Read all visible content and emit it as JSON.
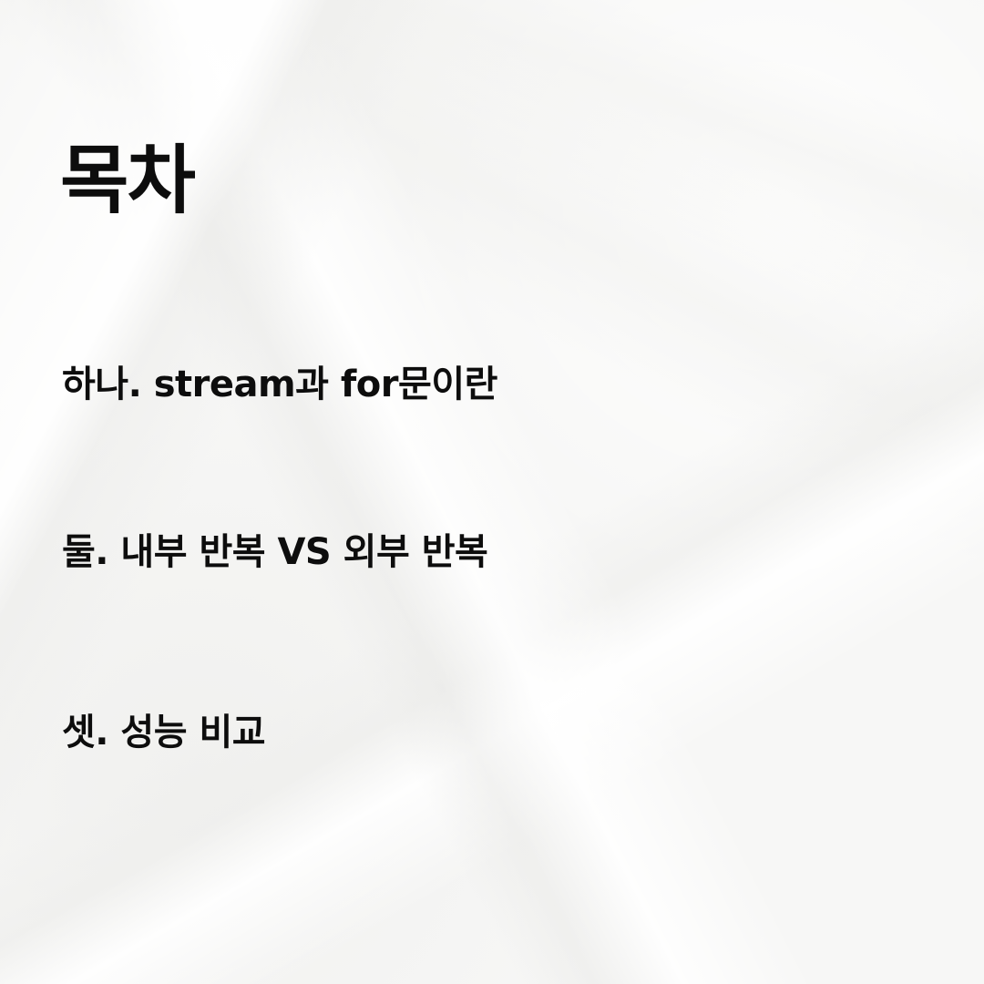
{
  "title": "목차",
  "toc": {
    "items": [
      {
        "label": "하나. stream과 for문이란"
      },
      {
        "label": "둘. 내부 반복 VS 외부 반복"
      },
      {
        "label": "셋. 성능 비교"
      }
    ]
  }
}
